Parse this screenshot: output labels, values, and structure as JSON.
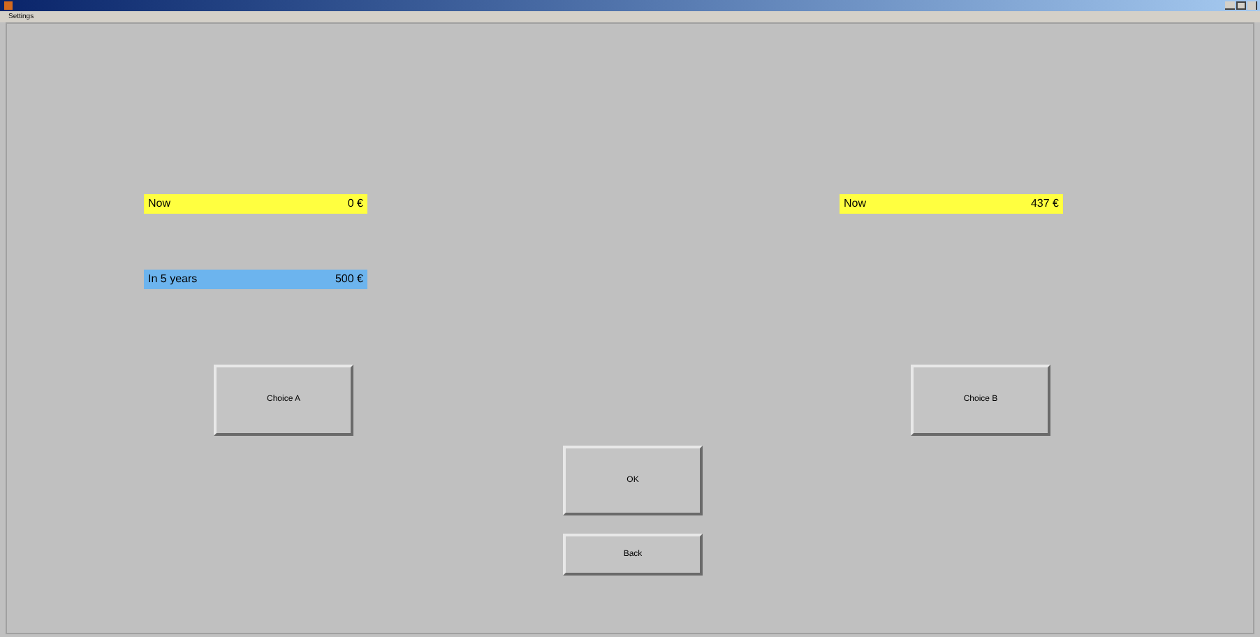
{
  "menu": [
    "Settings"
  ],
  "option_a": {
    "rows": [
      {
        "label": "Now",
        "value": "0 €",
        "color": "#ffff40"
      },
      {
        "label": "In 5 years",
        "value": "500 €",
        "color": "#6cb4ee"
      }
    ],
    "button": "Choice A"
  },
  "option_b": {
    "rows": [
      {
        "label": "Now",
        "value": "437 €",
        "color": "#ffff40"
      }
    ],
    "button": "Choice B"
  },
  "buttons": [
    "OK",
    "Back"
  ]
}
